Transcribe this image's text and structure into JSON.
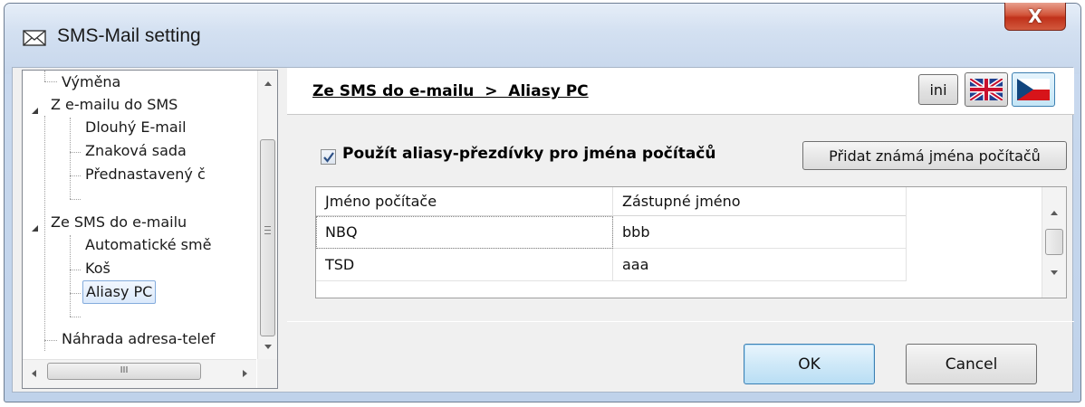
{
  "window": {
    "title": "SMS-Mail setting",
    "close_label": "X",
    "title_icon": "envelope-icon",
    "accent_color": "#c9d9ee",
    "close_color": "#c0311a"
  },
  "tree": {
    "items": [
      {
        "label": "Výměna",
        "level": 1,
        "expander": false
      },
      {
        "label": "Z e-mailu do SMS",
        "level": 0,
        "expander": true
      },
      {
        "label": "Dlouhý E-mail",
        "level": 1,
        "expander": false
      },
      {
        "label": "Znaková sada",
        "level": 1,
        "expander": false
      },
      {
        "label": "Přednastavený č",
        "level": 1,
        "expander": false
      },
      {
        "label": "Ze SMS do e-mailu",
        "level": 0,
        "expander": true
      },
      {
        "label": "Automatické smě",
        "level": 1,
        "expander": false
      },
      {
        "label": "Koš",
        "level": 1,
        "expander": false
      },
      {
        "label": "Aliasy PC",
        "level": 1,
        "expander": false,
        "selected": true
      },
      {
        "label": "Náhrada adresa-telef",
        "level": 1,
        "expander": false
      }
    ],
    "hscroll_grip": "III"
  },
  "header": {
    "breadcrumb": "Ze SMS do e-mailu  >  Aliasy PC",
    "ini_label": "ini",
    "flag_en": "uk-flag-icon",
    "flag_cz": "czech-flag-icon"
  },
  "options": {
    "use_aliases_label": "Použít aliasy-přezdívky pro jména počítačů",
    "use_aliases_checked": true,
    "add_known_label": "Přidat známá jména počítačů"
  },
  "grid": {
    "columns": [
      "Jméno počítače",
      "Zástupné jméno"
    ],
    "rows": [
      [
        "NBQ",
        "bbb"
      ],
      [
        "TSD",
        "aaa"
      ]
    ]
  },
  "footer": {
    "ok_label": "OK",
    "cancel_label": "Cancel"
  }
}
